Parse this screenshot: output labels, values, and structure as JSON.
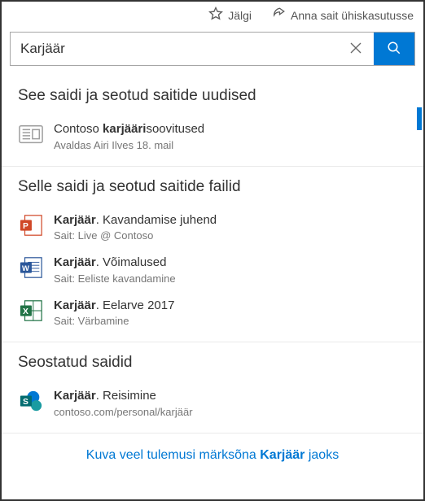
{
  "topbar": {
    "follow": "Jälgi",
    "share": "Anna sait ühiskasutusse"
  },
  "search": {
    "value": "Karjäär",
    "placeholder": ""
  },
  "sections": {
    "news": {
      "title": "See saidi ja seotud saitide uudised",
      "items": [
        {
          "title_pre": "Contoso ",
          "title_bold": "karjääri",
          "title_post": "soovitused",
          "sub": "Avaldas Airi Ilves 18. mail"
        }
      ]
    },
    "files": {
      "title": "Selle saidi ja seotud saitide failid",
      "items": [
        {
          "title_bold": "Karjäär",
          "title_post": ". Kavandamise juhend",
          "sub": "Sait: Live @ Contoso"
        },
        {
          "title_bold": "Karjäär",
          "title_post": ". Võimalused",
          "sub": "Sait: Eeliste kavandamine"
        },
        {
          "title_bold": "Karjäär",
          "title_post": ". Eelarve 2017",
          "sub": "Sait: Värbamine"
        }
      ]
    },
    "sites": {
      "title": "Seostatud saidid",
      "items": [
        {
          "title_bold": "Karjäär",
          "title_post": ". Reisimine",
          "sub": "contoso.com/personal/karjäär"
        }
      ]
    }
  },
  "footer": {
    "pre": "Kuva veel tulemusi märksõna ",
    "bold": "Karjäär",
    "post": " jaoks"
  }
}
